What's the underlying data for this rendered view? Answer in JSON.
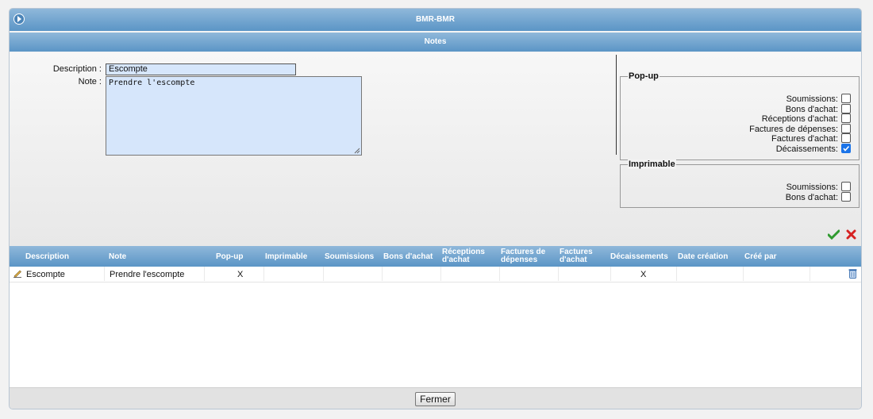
{
  "window": {
    "title": "BMR-BMR"
  },
  "panel": {
    "title": "Notes"
  },
  "form": {
    "description_label": "Description :",
    "description_value": "Escompte",
    "note_label": "Note :",
    "note_value": "Prendre l'escompte"
  },
  "popup": {
    "legend": "Pop-up",
    "items": [
      {
        "label": "Soumissions:",
        "checked": false
      },
      {
        "label": "Bons d'achat:",
        "checked": false
      },
      {
        "label": "Réceptions d'achat:",
        "checked": false
      },
      {
        "label": "Factures de dépenses:",
        "checked": false
      },
      {
        "label": "Factures d'achat:",
        "checked": false
      },
      {
        "label": "Décaissements:",
        "checked": true
      }
    ]
  },
  "imprimable": {
    "legend": "Imprimable",
    "items": [
      {
        "label": "Soumissions:",
        "checked": false
      },
      {
        "label": "Bons d'achat:",
        "checked": false
      }
    ]
  },
  "actions": {
    "save_icon": "check-icon",
    "cancel_icon": "x-icon"
  },
  "table": {
    "headers": {
      "description": "Description",
      "note": "Note",
      "popup": "Pop-up",
      "imprimable": "Imprimable",
      "soumissions": "Soumissions",
      "bons": "Bons d'achat",
      "receptions_1": "Réceptions",
      "receptions_2": "d'achat",
      "factdep_1": "Factures de",
      "factdep_2": "dépenses",
      "factachat_1": "Factures",
      "factachat_2": "d'achat",
      "decaissements": "Décaissements",
      "date": "Date création",
      "cree": "Créé par"
    },
    "rows": [
      {
        "description": "Escompte",
        "note": "Prendre l'escompte",
        "popup": "X",
        "imprimable": "",
        "soumissions": "",
        "bons": "",
        "receptions": "",
        "factdep": "",
        "factachat": "",
        "decaissements": "X",
        "date": "",
        "cree": ""
      }
    ]
  },
  "footer": {
    "close_label": "Fermer"
  },
  "colors": {
    "header_blue": "#5b95c6",
    "input_bg": "#d6e6fb",
    "check_blue": "#1a73e8"
  }
}
